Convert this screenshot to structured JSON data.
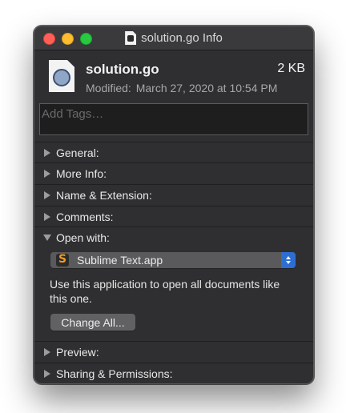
{
  "window": {
    "title": "solution.go Info"
  },
  "file": {
    "name": "solution.go",
    "size": "2 KB",
    "modified_label": "Modified:",
    "modified_value": "March 27, 2020 at 10:54 PM"
  },
  "tags": {
    "placeholder": "Add Tags…"
  },
  "sections": {
    "general": "General:",
    "more_info": "More Info:",
    "name_extension": "Name & Extension:",
    "comments": "Comments:",
    "open_with": "Open with:",
    "preview": "Preview:",
    "sharing": "Sharing & Permissions:"
  },
  "open_with": {
    "app_name": "Sublime Text.app",
    "description": "Use this application to open all documents like this one.",
    "change_all_label": "Change All..."
  },
  "colors": {
    "window_bg": "#2f2f31",
    "select_accent": "#2d6ed3",
    "close": "#ff5f57",
    "minimize": "#febc2e",
    "maximize": "#28c840"
  },
  "icons": {
    "title_doc": "document-icon",
    "file": "go-file-icon",
    "app": "sublime-text-icon"
  }
}
